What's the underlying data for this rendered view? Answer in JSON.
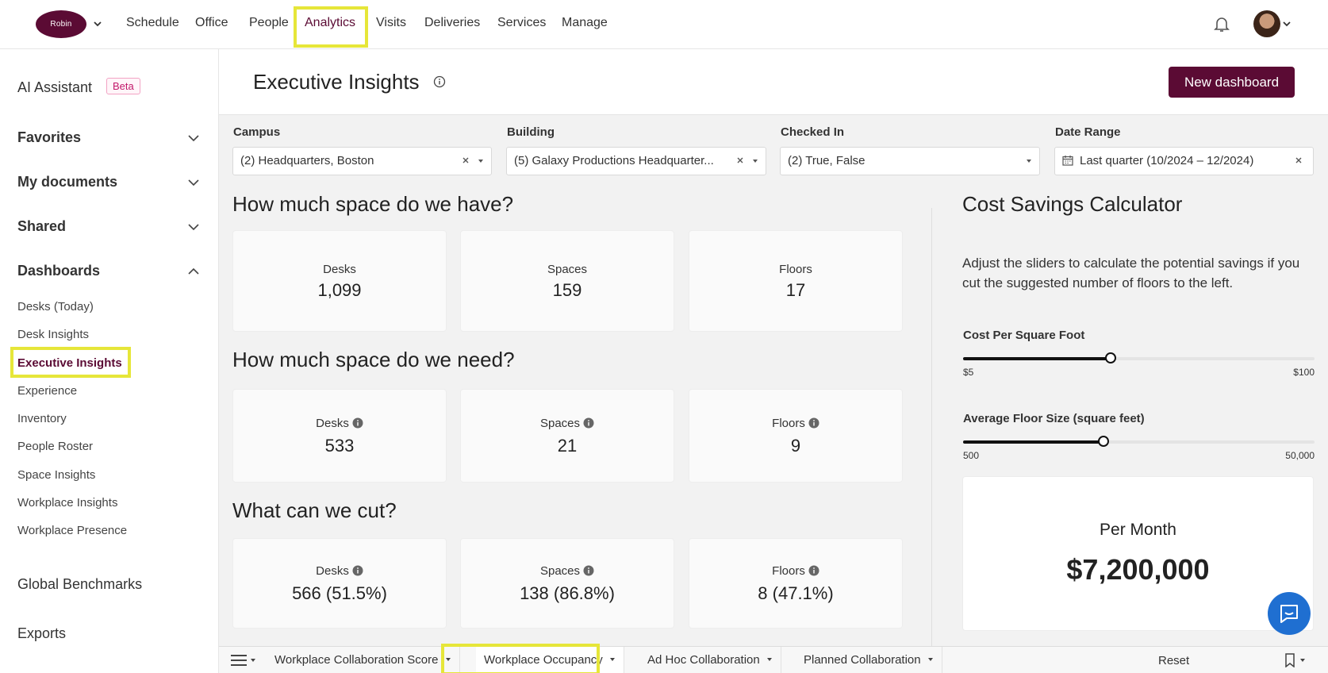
{
  "topnav": {
    "logo_text": "Robin",
    "items": [
      "Schedule",
      "Office",
      "People",
      "Analytics",
      "Visits",
      "Deliveries",
      "Services",
      "Manage"
    ],
    "active": "Analytics"
  },
  "sidebar": {
    "ai_label": "AI Assistant",
    "beta_label": "Beta",
    "sections": [
      "Favorites",
      "My documents",
      "Shared",
      "Dashboards"
    ],
    "dashboards": [
      "Desks (Today)",
      "Desk Insights",
      "Executive Insights",
      "Experience",
      "Inventory",
      "People Roster",
      "Space Insights",
      "Workplace Insights",
      "Workplace Presence"
    ],
    "active_dashboard": "Executive Insights",
    "bottom": [
      "Global Benchmarks",
      "Exports"
    ]
  },
  "header": {
    "title": "Executive Insights",
    "new_dashboard_label": "New dashboard"
  },
  "filters": {
    "campus": {
      "label": "Campus",
      "value": "(2) Headquarters, Boston"
    },
    "building": {
      "label": "Building",
      "value": "(5) Galaxy Productions Headquarter..."
    },
    "checked_in": {
      "label": "Checked In",
      "value": "(2) True, False"
    },
    "date_range": {
      "label": "Date Range",
      "value": "Last quarter (10/2024 – 12/2024)"
    }
  },
  "have": {
    "title": "How much space do we have?",
    "cards": [
      {
        "label": "Desks",
        "value": "1,099"
      },
      {
        "label": "Spaces",
        "value": "159"
      },
      {
        "label": "Floors",
        "value": "17"
      }
    ]
  },
  "need": {
    "title": "How much space do we need?",
    "cards": [
      {
        "label": "Desks",
        "value": "533"
      },
      {
        "label": "Spaces",
        "value": "21"
      },
      {
        "label": "Floors",
        "value": "9"
      }
    ]
  },
  "cut": {
    "title": "What can we cut?",
    "cards": [
      {
        "label": "Desks",
        "value": "566 (51.5%)"
      },
      {
        "label": "Spaces",
        "value": "138 (86.8%)"
      },
      {
        "label": "Floors",
        "value": "8 (47.1%)"
      }
    ]
  },
  "calculator": {
    "title": "Cost Savings Calculator",
    "description": "Adjust the sliders to calculate the potential savings if you cut the suggested number of floors to the left.",
    "cost_slider": {
      "label": "Cost Per Square Foot",
      "min": "$5",
      "max": "$100",
      "fraction": 0.42
    },
    "floor_slider": {
      "label": "Average Floor Size (square feet)",
      "min": "500",
      "max": "50,000",
      "fraction": 0.4
    },
    "per_month_label": "Per Month",
    "per_month_value": "$7,200,000"
  },
  "tabs": {
    "items": [
      "Workplace Collaboration Score",
      "Workplace Occupancy",
      "Ad Hoc Collaboration",
      "Planned Collaboration"
    ],
    "active": "Workplace Occupancy",
    "reset_label": "Reset"
  },
  "colors": {
    "brand": "#5b0b34",
    "highlight": "#e6e639",
    "chat": "#1f6fd1"
  }
}
